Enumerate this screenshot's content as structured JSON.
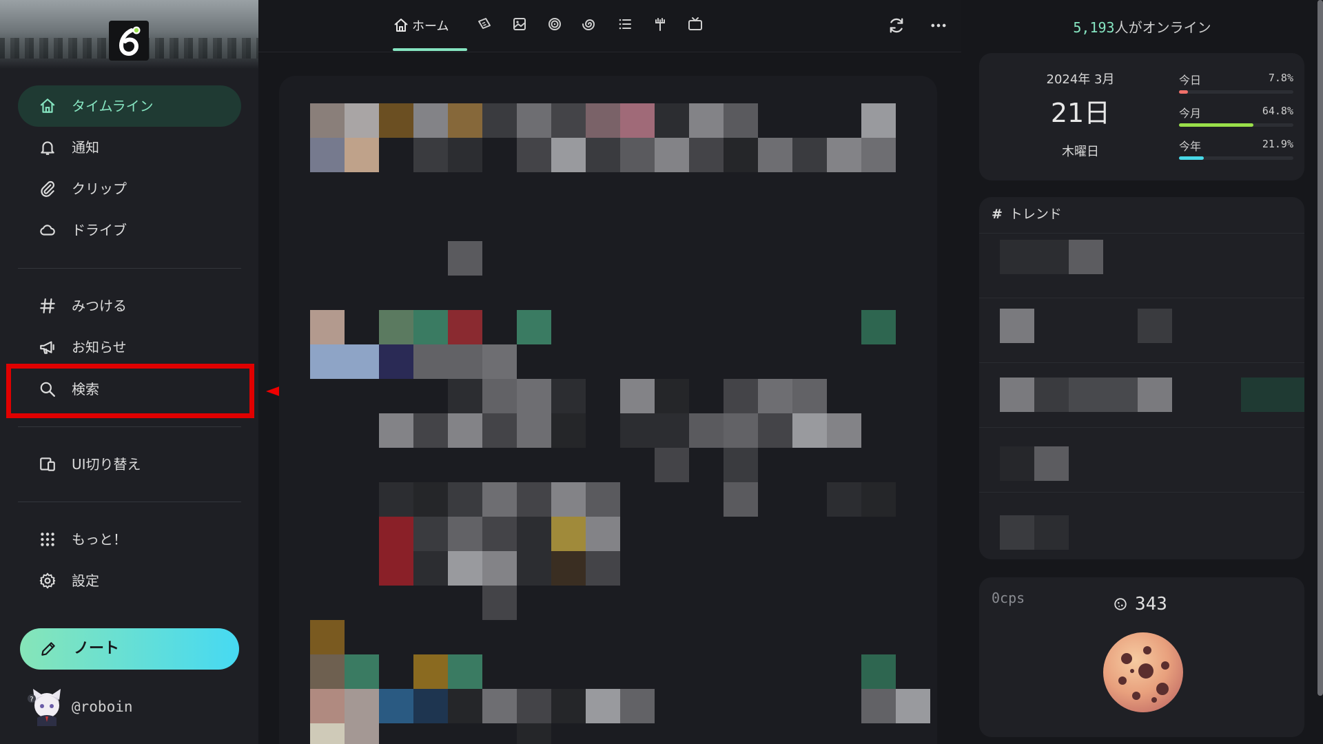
{
  "sidebar": {
    "items": [
      {
        "label": "タイムライン",
        "icon": "home-icon",
        "active": true
      },
      {
        "label": "通知",
        "icon": "bell-icon"
      },
      {
        "label": "クリップ",
        "icon": "paperclip-icon"
      },
      {
        "label": "ドライブ",
        "icon": "cloud-icon"
      },
      {
        "label": "みつける",
        "icon": "hash-icon"
      },
      {
        "label": "お知らせ",
        "icon": "megaphone-icon"
      },
      {
        "label": "検索",
        "icon": "search-icon"
      },
      {
        "label": "UI切り替え",
        "icon": "devices-icon"
      },
      {
        "label": "もっと！",
        "icon": "grid-dots-icon"
      },
      {
        "label": "設定",
        "icon": "gear-icon"
      }
    ],
    "note_button": "ノート",
    "account": "@roboin"
  },
  "topbar": {
    "home_tab": "ホーム",
    "tab_icons": [
      "local-timeline-icon",
      "media-icon",
      "social-timeline-icon",
      "global-timeline-icon",
      "list-icon",
      "antenna-icon",
      "channel-icon"
    ]
  },
  "right": {
    "online_count": "5,193",
    "online_suffix": "人がオンライン",
    "calendar": {
      "year_month": "2024年 3月",
      "day": "21日",
      "weekday": "木曜日",
      "stats": [
        {
          "label": "今日",
          "value": "7.8%",
          "fraction": 0.078,
          "color": "#f0706a"
        },
        {
          "label": "今月",
          "value": "64.8%",
          "fraction": 0.648,
          "color": "#9ae04a"
        },
        {
          "label": "今年",
          "value": "21.9%",
          "fraction": 0.219,
          "color": "#48d9e8"
        }
      ]
    },
    "trend": {
      "hash": "#",
      "title": "トレンド"
    },
    "cookie": {
      "cps": "0cps",
      "count": "343"
    }
  },
  "colors": {
    "accent": "#86e5c1",
    "annotation": "#e00000"
  }
}
